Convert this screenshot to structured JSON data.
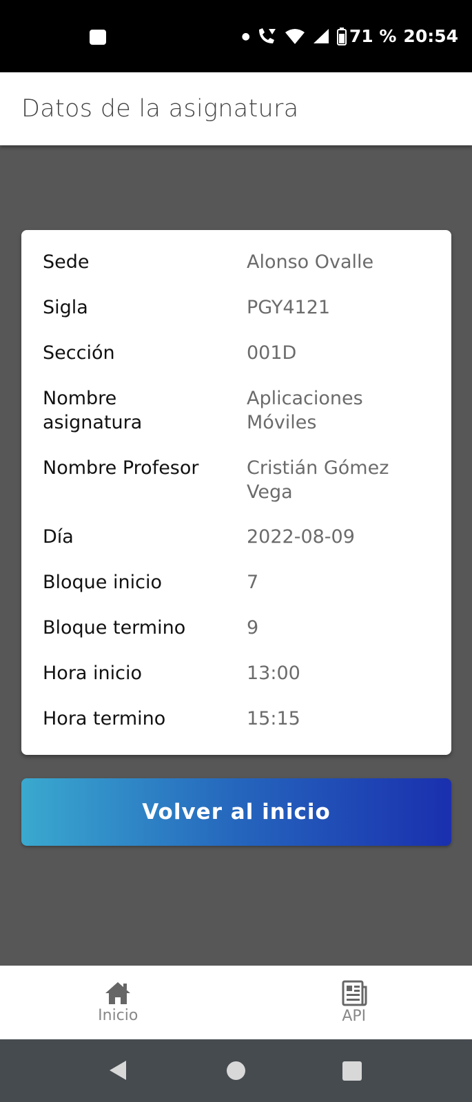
{
  "status_bar": {
    "battery_text": "71 %",
    "time": "20:54"
  },
  "header": {
    "title": "Datos de la asignatura"
  },
  "details": [
    {
      "label": "Sede",
      "value": "Alonso Ovalle"
    },
    {
      "label": "Sigla",
      "value": "PGY4121"
    },
    {
      "label": "Sección",
      "value": "001D"
    },
    {
      "label": "Nombre asignatura",
      "value": "Aplicaciones Móviles"
    },
    {
      "label": "Nombre Profesor",
      "value": "Cristián Gómez Vega"
    },
    {
      "label": "Día",
      "value": "2022-08-09"
    },
    {
      "label": "Bloque inicio",
      "value": "7"
    },
    {
      "label": "Bloque termino",
      "value": "9"
    },
    {
      "label": "Hora inicio",
      "value": "13:00"
    },
    {
      "label": "Hora termino",
      "value": "15:15"
    }
  ],
  "actions": {
    "back_label": "Volver al inicio"
  },
  "tabs": [
    {
      "label": "Inicio",
      "icon": "home-icon"
    },
    {
      "label": "API",
      "icon": "newspaper-icon"
    }
  ],
  "colors": {
    "button_gradient_start": "#3aa9cf",
    "button_gradient_end": "#1a2fae",
    "background": "#575757"
  }
}
